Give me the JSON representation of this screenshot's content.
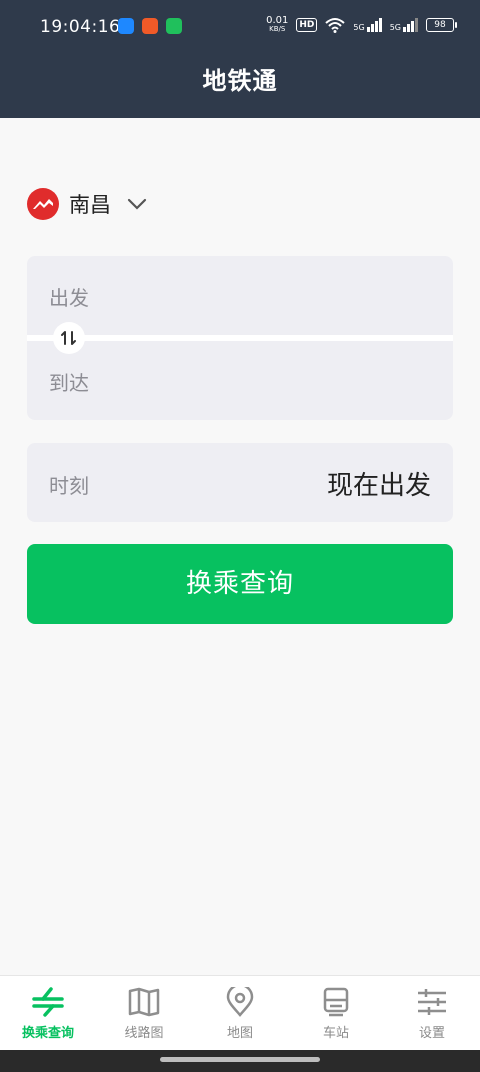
{
  "status_bar": {
    "time": "19:04:16",
    "net_speed": "0.01",
    "net_speed_unit": "KB/S",
    "hd_badge": "HD",
    "signal_1": "5G",
    "signal_2": "5G",
    "battery": "98"
  },
  "header": {
    "title": "地铁通"
  },
  "city": {
    "name": "南昌"
  },
  "route": {
    "origin_placeholder": "出发",
    "destination_placeholder": "到达"
  },
  "time": {
    "label": "时刻",
    "value": "现在出发"
  },
  "search_button": "换乘查询",
  "tabs": [
    {
      "label": "换乘查询",
      "icon": "transfer-icon"
    },
    {
      "label": "线路图",
      "icon": "map-book-icon"
    },
    {
      "label": "地图",
      "icon": "location-pin-icon"
    },
    {
      "label": "车站",
      "icon": "station-icon"
    },
    {
      "label": "设置",
      "icon": "sliders-icon"
    }
  ],
  "colors": {
    "accent": "#07c160",
    "header_bg": "#2f3a4b",
    "city_logo": "#e02c2c"
  }
}
